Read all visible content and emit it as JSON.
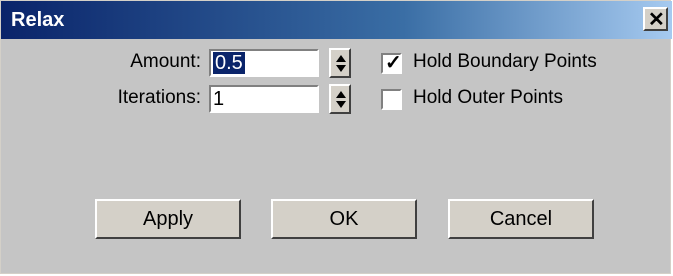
{
  "window": {
    "title": "Relax",
    "close_glyph": "✕",
    "close_icon": "close-icon"
  },
  "fields": {
    "amount": {
      "label": "Amount:",
      "value": "0.5"
    },
    "iterations": {
      "label": "Iterations:",
      "value": "1"
    }
  },
  "checkboxes": [
    {
      "label": "Hold Boundary Points",
      "checked": true
    },
    {
      "label": "Hold Outer Points",
      "checked": false
    }
  ],
  "buttons": {
    "apply": "Apply",
    "ok": "OK",
    "cancel": "Cancel"
  },
  "colors": {
    "title_bar_start": "#0a246a",
    "title_bar_end": "#a6caf0",
    "dialog_bg": "#c5c5c5",
    "selection": "#0a246a"
  }
}
